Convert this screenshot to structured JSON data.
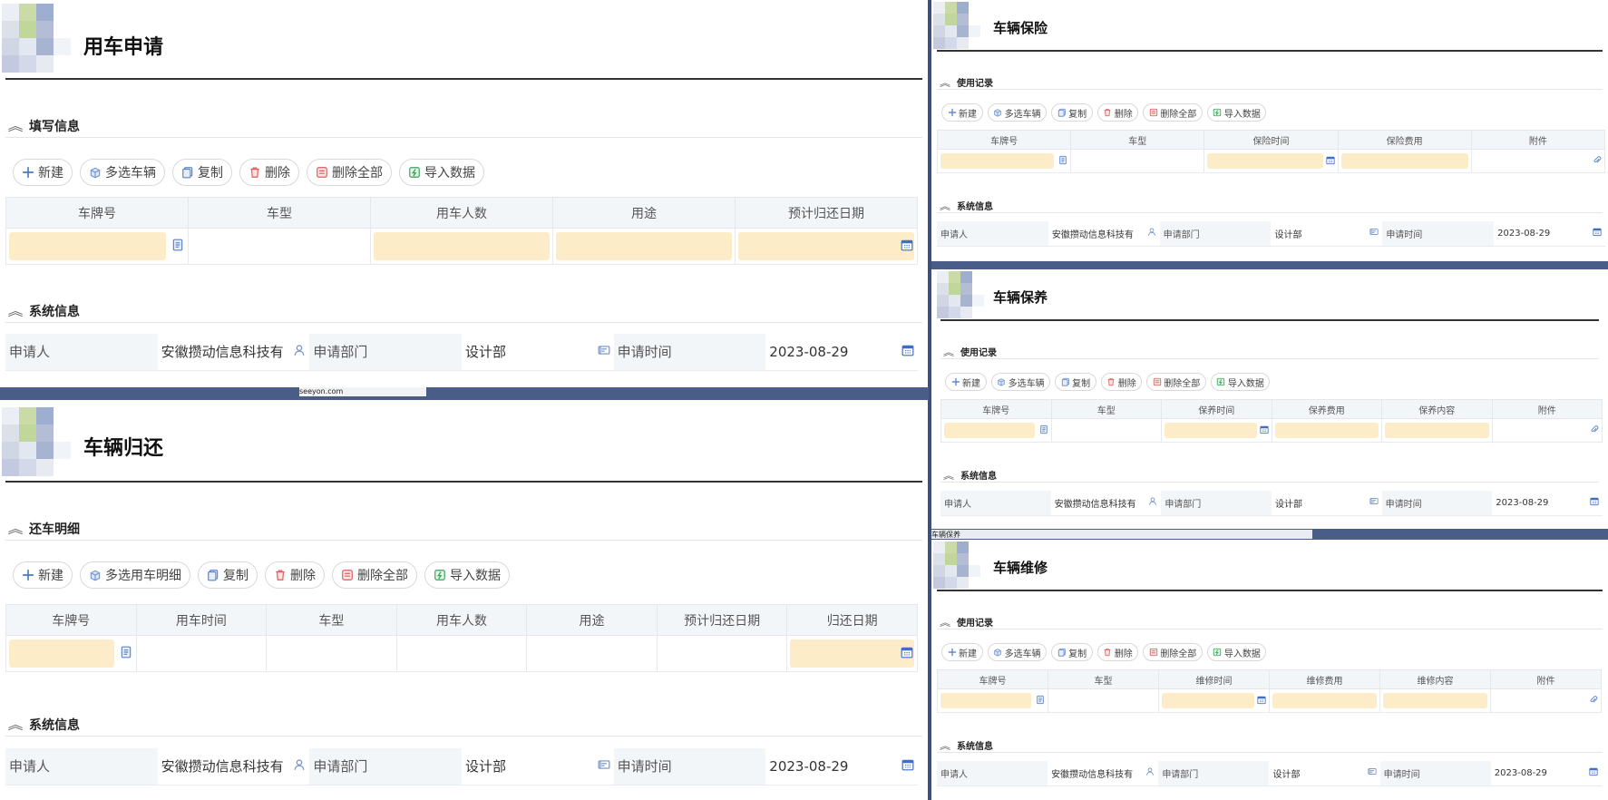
{
  "forms": {
    "apply": {
      "title": "用车申请",
      "section1": "填写信息",
      "buttons": [
        "新建",
        "多选车辆",
        "复制",
        "删除",
        "删除全部",
        "导入数据"
      ],
      "columns": [
        "车牌号",
        "车型",
        "用车人数",
        "用途",
        "预计归还日期"
      ],
      "section2": "系统信息",
      "sys": {
        "applicant_label": "申请人",
        "applicant_value": "安徽攒动信息科技有",
        "dept_label": "申请部门",
        "dept_value": "设计部",
        "time_label": "申请时间",
        "time_value": "2023-08-29"
      }
    },
    "return": {
      "title": "车辆归还",
      "section1": "还车明细",
      "buttons": [
        "新建",
        "多选用车明细",
        "复制",
        "删除",
        "删除全部",
        "导入数据"
      ],
      "columns": [
        "车牌号",
        "用车时间",
        "车型",
        "用车人数",
        "用途",
        "预计归还日期",
        "归还日期"
      ],
      "section2": "系统信息",
      "sys": {
        "applicant_label": "申请人",
        "applicant_value": "安徽攒动信息科技有",
        "dept_label": "申请部门",
        "dept_value": "设计部",
        "time_label": "申请时间",
        "time_value": "2023-08-29"
      }
    },
    "insurance": {
      "title": "车辆保险",
      "section1": "使用记录",
      "buttons": [
        "新建",
        "多选车辆",
        "复制",
        "删除",
        "删除全部",
        "导入数据"
      ],
      "columns": [
        "车牌号",
        "车型",
        "保险时间",
        "保险费用",
        "附件"
      ],
      "section2": "系统信息",
      "sys": {
        "applicant_label": "申请人",
        "applicant_value": "安徽攒动信息科技有",
        "dept_label": "申请部门",
        "dept_value": "设计部",
        "time_label": "申请时间",
        "time_value": "2023-08-29"
      }
    },
    "maintenance": {
      "title": "车辆保养",
      "section1": "使用记录",
      "buttons": [
        "新建",
        "多选车辆",
        "复制",
        "删除",
        "删除全部",
        "导入数据"
      ],
      "columns": [
        "车牌号",
        "车型",
        "保养时间",
        "保养费用",
        "保养内容",
        "附件"
      ],
      "section2": "系统信息",
      "sys": {
        "applicant_label": "申请人",
        "applicant_value": "安徽攒动信息科技有",
        "dept_label": "申请部门",
        "dept_value": "设计部",
        "time_label": "申请时间",
        "time_value": "2023-08-29"
      }
    },
    "repair": {
      "title": "车辆维修",
      "section1": "使用记录",
      "buttons": [
        "新建",
        "多选车辆",
        "复制",
        "删除",
        "删除全部",
        "导入数据"
      ],
      "columns": [
        "车牌号",
        "车型",
        "维修时间",
        "维修费用",
        "维修内容",
        "附件"
      ],
      "section2": "系统信息",
      "sys": {
        "applicant_label": "申请人",
        "applicant_value": "安徽攒动信息科技有",
        "dept_label": "申请部门",
        "dept_value": "设计部",
        "time_label": "申请时间",
        "time_value": "2023-08-29"
      }
    }
  },
  "strips": {
    "left_middle": "seeyon.com",
    "right_middle": "车辆保养"
  },
  "icons": {
    "add": "plus-icon",
    "multi": "cube-icon",
    "copy": "copy-icon",
    "delete": "trash-icon",
    "delete_all": "delete-all-icon",
    "import": "import-icon",
    "section": "double-chevron-up-icon",
    "lookup": "lookup-icon",
    "calendar": "calendar-icon",
    "person": "person-icon",
    "dept": "dept-icon",
    "attach": "paperclip-icon"
  },
  "colors": {
    "fill": "#fdecc8",
    "header_bg": "#f3f6f9",
    "accent": "#5a82c8",
    "delete": "#e05a5a",
    "import": "#3aa35a",
    "divider": "#3d4f7a"
  }
}
